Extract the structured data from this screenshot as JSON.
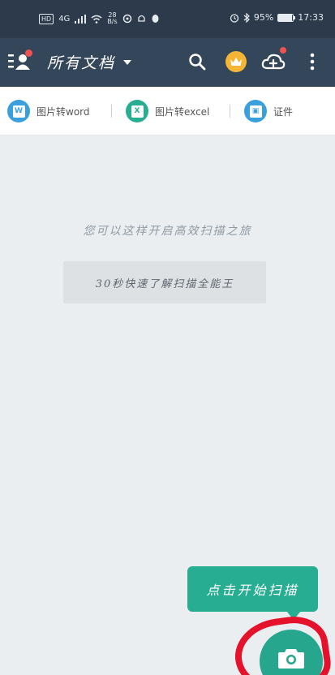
{
  "status_bar": {
    "hd": "HD",
    "network": "4G",
    "speed_value": "28",
    "speed_unit": "B/s",
    "battery_text": "95%",
    "battery_level": 0.95,
    "time": "17:33"
  },
  "app_bar": {
    "title": "所有文档",
    "icons": [
      "profile-menu-icon",
      "search-icon",
      "crown-icon",
      "cloud-upload-icon",
      "more-vertical-icon"
    ],
    "crown_color": "#f6b534",
    "badge_color": "#f05252"
  },
  "shortcuts": [
    {
      "label": "图片转word",
      "icon": "word-icon",
      "color": "#3a9fdd",
      "glyph": "W"
    },
    {
      "label": "图片转excel",
      "icon": "excel-icon",
      "color": "#27ad92",
      "glyph": "X"
    },
    {
      "label": "证件",
      "icon": "id-card-icon",
      "color": "#3a9fdd",
      "glyph": "▣"
    }
  ],
  "main": {
    "hint": "您可以这样开启高效扫描之旅",
    "tutorial_button": "30秒快速了解扫描全能王"
  },
  "tooltip": {
    "text": "点击开始扫描"
  },
  "fab": {
    "icon": "camera-icon",
    "color": "#26a68c"
  }
}
